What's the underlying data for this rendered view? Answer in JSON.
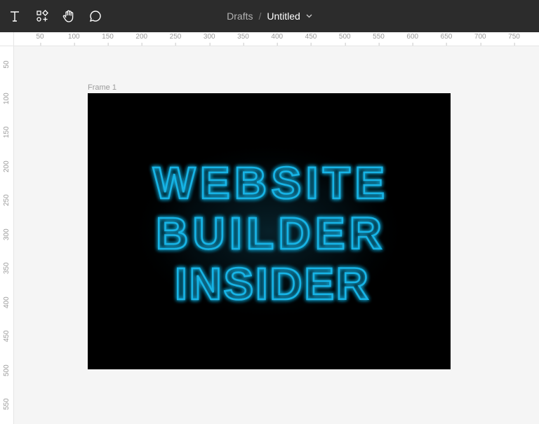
{
  "toolbar": {
    "tools": [
      {
        "name": "text-tool-icon"
      },
      {
        "name": "components-tool-icon"
      },
      {
        "name": "hand-tool-icon"
      },
      {
        "name": "comment-tool-icon"
      }
    ],
    "breadcrumb_parent": "Drafts",
    "breadcrumb_separator": "/",
    "file_title": "Untitled"
  },
  "rulers": {
    "horizontal": [
      "50",
      "100",
      "150",
      "200",
      "250",
      "300",
      "350",
      "400",
      "450",
      "500",
      "550",
      "600",
      "650",
      "700",
      "750"
    ],
    "vertical": [
      "50",
      "100",
      "150",
      "200",
      "250",
      "300",
      "350",
      "400",
      "450",
      "500",
      "550"
    ]
  },
  "frame": {
    "label": "Frame 1",
    "text_lines": [
      "WEBSITE",
      "BUILDER",
      "INSIDER"
    ],
    "neon_color": "#19b4e6",
    "background": "#000000"
  }
}
